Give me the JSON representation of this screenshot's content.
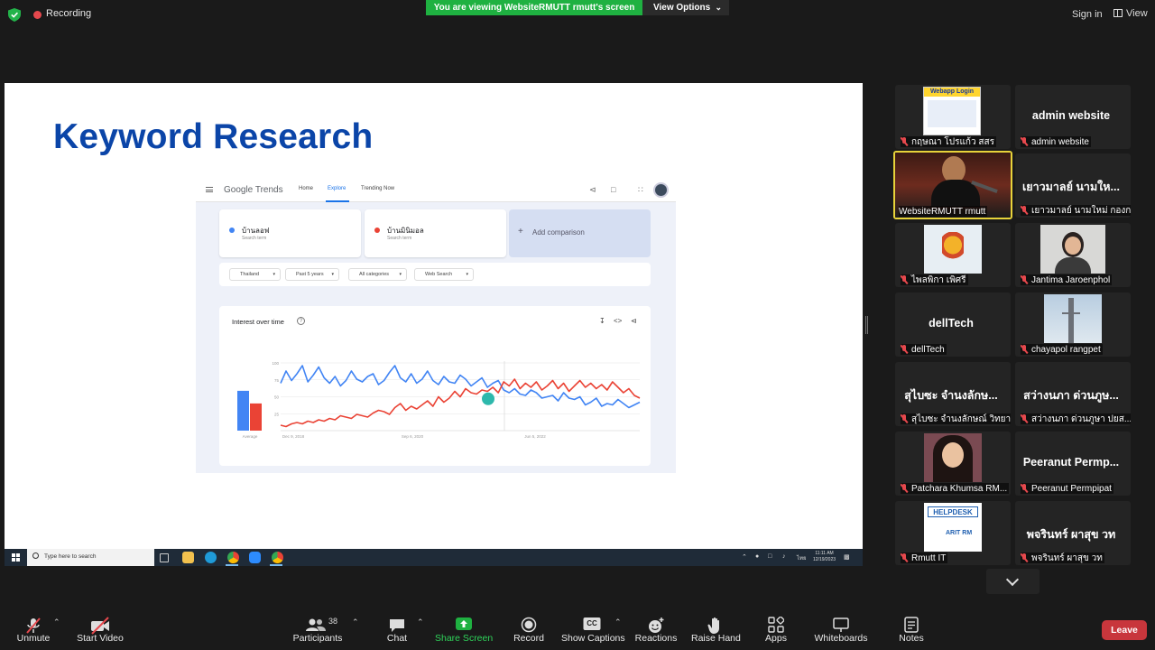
{
  "top_bar": {
    "recording_label": "Recording",
    "viewing_banner": "You are viewing WebsiteRMUTT rmutt's screen",
    "view_options_label": "View Options",
    "sign_in_label": "Sign in",
    "view_label": "View"
  },
  "shared_screen": {
    "slide_title": "Keyword Research",
    "trends": {
      "logo": "Google Trends",
      "nav": [
        "Home",
        "Explore",
        "Trending Now"
      ],
      "active_nav": "Explore",
      "terms": [
        {
          "name": "บ้านลอฟ",
          "sub": "Search term",
          "color": "#4285f4"
        },
        {
          "name": "บ้านมินิมอล",
          "sub": "Search term",
          "color": "#ea4335"
        }
      ],
      "add_comparison": "Add comparison",
      "filters": [
        "Thailand",
        "Past 5 years",
        "All categories",
        "Web Search"
      ],
      "chart_card_title": "Interest over time"
    },
    "taskbar": {
      "search_placeholder": "Type here to search",
      "time": "11:11 AM",
      "date": "12/19/2023",
      "lang": "ไทย"
    }
  },
  "chart_data": {
    "type": "line",
    "title": "Interest over time",
    "x_tick_labels": [
      "Dec 9, 2018",
      "Sep 6, 2020",
      "Jun 5, 2022"
    ],
    "y_tick_labels": [
      "100",
      "75",
      "50",
      "25"
    ],
    "ylim": [
      0,
      100
    ],
    "average_bars": {
      "label": "Average",
      "values": [
        63,
        43
      ]
    },
    "series": [
      {
        "color": "#4285f4",
        "values": [
          70,
          88,
          74,
          84,
          96,
          72,
          82,
          94,
          78,
          70,
          80,
          66,
          74,
          88,
          76,
          72,
          80,
          84,
          68,
          74,
          86,
          96,
          78,
          72,
          84,
          70,
          76,
          88,
          74,
          68,
          80,
          72,
          70,
          82,
          76,
          66,
          72,
          78,
          64,
          70,
          74,
          60,
          56,
          62,
          54,
          52,
          60,
          56,
          48,
          50,
          52,
          44,
          56,
          48,
          46,
          50,
          38,
          42,
          48,
          36,
          40,
          38,
          46,
          40,
          34,
          38,
          42
        ]
      },
      {
        "color": "#ea4335",
        "values": [
          8,
          6,
          10,
          12,
          10,
          14,
          12,
          16,
          14,
          18,
          16,
          22,
          20,
          18,
          24,
          22,
          20,
          26,
          30,
          28,
          24,
          34,
          40,
          30,
          36,
          32,
          38,
          44,
          36,
          50,
          42,
          48,
          58,
          50,
          62,
          56,
          54,
          60,
          58,
          64,
          56,
          72,
          66,
          76,
          62,
          70,
          64,
          72,
          60,
          66,
          74,
          62,
          70,
          58,
          66,
          74,
          64,
          70,
          62,
          68,
          60,
          72,
          64,
          56,
          62,
          52,
          48
        ]
      }
    ]
  },
  "participants_tiles": [
    {
      "name": "กฤษณา โปรแก้ว สสร",
      "big": "",
      "image": "webapp-login-thumbnail"
    },
    {
      "name": "admin website",
      "big": "admin website",
      "image": ""
    },
    {
      "name": "WebsiteRMUTT rmutt",
      "big": "",
      "image": "presenter-video",
      "active": true
    },
    {
      "name": "เยาวมาลย์ นามใหม่ กองก...",
      "big": "เยาวมาลย์ นามให...",
      "image": ""
    },
    {
      "name": "ไพลพิกา เพิ่ศรี",
      "big": "",
      "image": "university-logo"
    },
    {
      "name": "Jantima Jaroenphol",
      "big": "",
      "image": "woman-photo"
    },
    {
      "name": "dellTech",
      "big": "dellTech",
      "image": ""
    },
    {
      "name": "chayapol rangpet",
      "big": "",
      "image": "tower-photo"
    },
    {
      "name": "สุไบซะ จำนงลักษณ์ วิทยา...",
      "big": "สุไบซะ จำนงลักษ...",
      "image": ""
    },
    {
      "name": "สว่างนภา ด่วนภูษา ปยส...",
      "big": "สว่างนภา ด่วนภูษ...",
      "image": ""
    },
    {
      "name": "Patchara Khumsa RM...",
      "big": "",
      "image": "woman-selfie"
    },
    {
      "name": "Peeranut Permpipat",
      "big": "Peeranut Permp...",
      "image": ""
    },
    {
      "name": "Rmutt IT",
      "big": "",
      "image": "helpdesk-logo",
      "image_text": "HELPDESK",
      "image_text2": "ARIT RM"
    },
    {
      "name": "พจรินทร์ ผาสุข วท",
      "big": "พจรินทร์ ผาสุข วท",
      "image": ""
    }
  ],
  "controls": {
    "unmute": "Unmute",
    "start_video": "Start Video",
    "participants": "Participants",
    "participants_count": "38",
    "chat": "Chat",
    "share_screen": "Share Screen",
    "record": "Record",
    "show_captions": "Show Captions",
    "captions_badge": "CC",
    "reactions": "Reactions",
    "raise_hand": "Raise Hand",
    "apps": "Apps",
    "whiteboards": "Whiteboards",
    "notes": "Notes",
    "leave": "Leave"
  },
  "colors": {
    "accent_green": "#1fb141",
    "leave_red": "#c8363c",
    "muted_red": "#e5484d",
    "slide_title_blue": "#0b45a8"
  }
}
